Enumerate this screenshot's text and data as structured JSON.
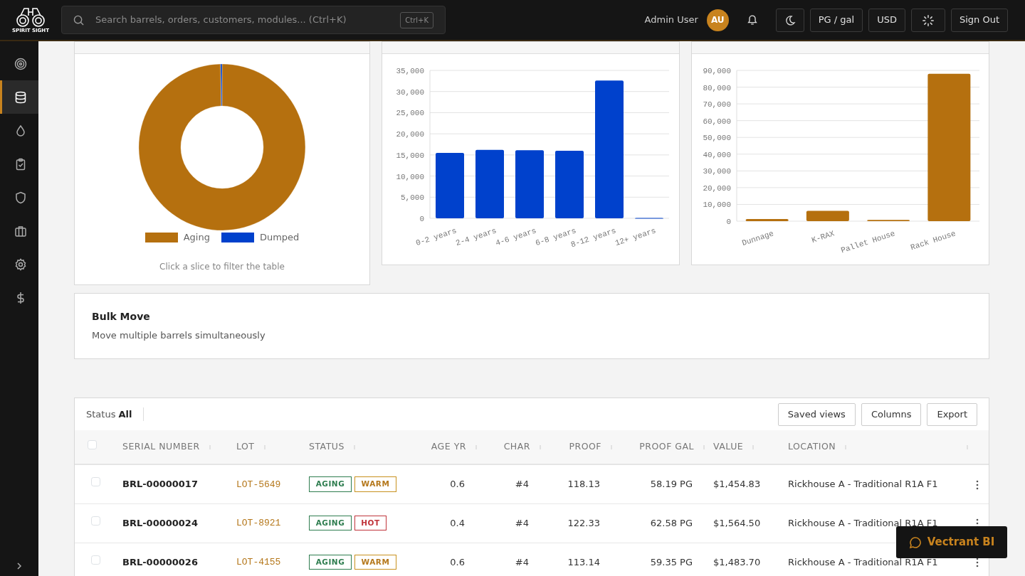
{
  "logo": {
    "text": "SPIRIT SIGHT"
  },
  "search": {
    "placeholder": "Search barrels, orders, customers, modules... (Ctrl+K)",
    "shortcut": "Ctrl+K"
  },
  "user": {
    "name": "Admin User",
    "initials": "AU"
  },
  "toolbar": {
    "unit": "PG / gal",
    "currency": "USD",
    "sign_out": "Sign Out"
  },
  "sidebar": {
    "items": [
      {
        "selected": false
      },
      {
        "selected": true
      },
      {
        "selected": false
      },
      {
        "selected": false
      },
      {
        "selected": false
      },
      {
        "selected": false
      },
      {
        "selected": false
      },
      {
        "selected": false
      }
    ]
  },
  "status_chart": {
    "caption": "Click a slice to filter the table",
    "chart_data": {
      "type": "donut",
      "categories": [
        "Aging",
        "Dumped"
      ],
      "values": [
        99.7,
        0.3
      ],
      "colors": [
        "#b5700f",
        "#0041cc"
      ]
    }
  },
  "aging_chart": {
    "chart_data": {
      "type": "bar",
      "categories": [
        "0-2 years",
        "2-4 years",
        "4-6 years",
        "6-8 years",
        "8-12 years",
        "12+ years"
      ],
      "series": [
        {
          "color": "#0041cc",
          "values": [
            15500,
            16200,
            16100,
            16000,
            32600,
            100
          ]
        }
      ],
      "grid": true,
      "ylim": [
        0,
        35000
      ],
      "yticks": [
        {
          "value": 0,
          "label": "0"
        },
        {
          "value": 5000,
          "label": "5,000"
        },
        {
          "value": 10000,
          "label": "10,000"
        },
        {
          "value": 15000,
          "label": "15,000"
        },
        {
          "value": 20000,
          "label": "20,000"
        },
        {
          "value": 25000,
          "label": "25,000"
        },
        {
          "value": 30000,
          "label": "30,000"
        },
        {
          "value": 35000,
          "label": "35,000"
        }
      ]
    }
  },
  "warehouse_chart": {
    "chart_data": {
      "type": "bar",
      "categories": [
        "Dunnage",
        "K-RAX",
        "Pallet House",
        "Rack House"
      ],
      "series": [
        {
          "color": "#b5700f",
          "values": [
            1300,
            6200,
            700,
            88000
          ]
        }
      ],
      "grid": true,
      "ylim": [
        0,
        90000
      ],
      "yticks": [
        {
          "value": 0,
          "label": "0"
        },
        {
          "value": 10000,
          "label": "10,000"
        },
        {
          "value": 20000,
          "label": "20,000"
        },
        {
          "value": 30000,
          "label": "30,000"
        },
        {
          "value": 40000,
          "label": "40,000"
        },
        {
          "value": 50000,
          "label": "50,000"
        },
        {
          "value": 60000,
          "label": "60,000"
        },
        {
          "value": 70000,
          "label": "70,000"
        },
        {
          "value": 80000,
          "label": "80,000"
        },
        {
          "value": 90000,
          "label": "90,000"
        }
      ]
    }
  },
  "bulk_move": {
    "title": "Bulk Move",
    "description": "Move multiple barrels simultaneously"
  },
  "table": {
    "filter_label": "Status",
    "filter_value": "All",
    "buttons": [
      "Saved views",
      "Columns",
      "Export"
    ],
    "all_checked": false,
    "columns": [
      "SERIAL NUMBER",
      "LOT",
      "STATUS",
      "AGE YR",
      "CHAR",
      "PROOF",
      "PROOF GAL",
      "VALUE",
      "LOCATION"
    ],
    "rows": [
      {
        "checked": false,
        "serial": "BRL-00000017",
        "lot": "LOT-5649",
        "statuses": [
          {
            "kind": "aging",
            "text": "AGING"
          },
          {
            "kind": "warm",
            "text": "WARM"
          }
        ],
        "age": "0.6",
        "char": "#4",
        "proof": "118.13",
        "proof_gal": "58.19 PG",
        "value": "$1,454.83",
        "location": "Rickhouse A - Traditional R1A F1"
      },
      {
        "checked": false,
        "serial": "BRL-00000024",
        "lot": "LOT-8921",
        "statuses": [
          {
            "kind": "aging",
            "text": "AGING"
          },
          {
            "kind": "hot",
            "text": "HOT"
          }
        ],
        "age": "0.4",
        "char": "#4",
        "proof": "122.33",
        "proof_gal": "62.58 PG",
        "value": "$1,564.50",
        "location": "Rickhouse A - Traditional R1A F1"
      },
      {
        "checked": false,
        "serial": "BRL-00000026",
        "lot": "LOT-4155",
        "statuses": [
          {
            "kind": "aging",
            "text": "AGING"
          },
          {
            "kind": "warm",
            "text": "WARM"
          }
        ],
        "age": "0.6",
        "char": "#4",
        "proof": "113.14",
        "proof_gal": "59.35 PG",
        "value": "$1,483.70",
        "location": "Rickhouse A - Traditional R1A F1"
      }
    ]
  },
  "assistant": {
    "label": "Vectrant BI"
  }
}
